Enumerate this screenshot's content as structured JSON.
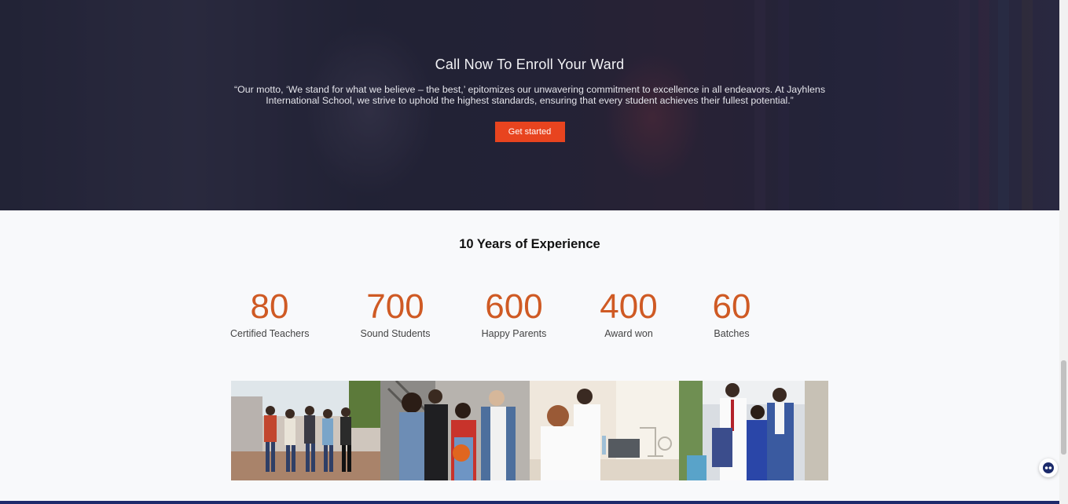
{
  "hero": {
    "title": "Call Now To Enroll Your Ward",
    "quote": "“Our motto, ‘We stand for what we believe – the best,’ epitomizes our unwavering commitment to excellence in all endeavors. At Jayhlens International School, we strive to uphold the highest standards, ensuring that every student achieves their fullest potential.”",
    "cta_label": "Get started"
  },
  "experience": {
    "title": "10 Years of Experience",
    "stats": [
      {
        "value": "80",
        "label": "Certified Teachers"
      },
      {
        "value": "700",
        "label": "Sound Students"
      },
      {
        "value": "600",
        "label": "Happy Parents"
      },
      {
        "value": "400",
        "label": "Award won"
      },
      {
        "value": "60",
        "label": "Batches"
      }
    ]
  },
  "colors": {
    "accent": "#e8441f",
    "stat_number": "#cf5a24",
    "footer": "#1e2a6b"
  },
  "icons": {
    "chat": "chat-assistant-icon"
  }
}
